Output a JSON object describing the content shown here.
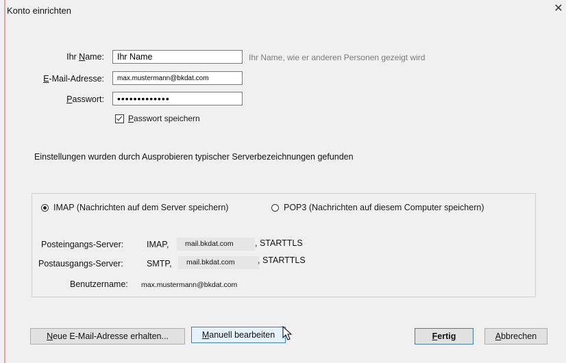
{
  "window": {
    "title": "Konto einrichten",
    "close_symbol": "✕"
  },
  "form": {
    "name": {
      "label_pre": "Ihr ",
      "label_u": "N",
      "label_post": "ame:",
      "value": "Ihr Name",
      "hint": "Ihr Name, wie er anderen Personen gezeigt wird"
    },
    "email": {
      "label_u": "E",
      "label_post": "-Mail-Adresse:",
      "value": "max.mustermann@bkdat.com"
    },
    "password": {
      "label_u": "P",
      "label_post": "asswort:",
      "value": "•••••••••••••"
    },
    "remember": {
      "label_u": "P",
      "label_post": "asswort speichern",
      "checked": true
    }
  },
  "info": "Einstellungen wurden durch Ausprobieren typischer Serverbezeichnungen gefunden",
  "protocols": {
    "imap_label": "IMAP (Nachrichten auf dem Server speichern)",
    "pop3_label": "POP3 (Nachrichten auf diesem Computer speichern)",
    "selected": "IMAP"
  },
  "servers": {
    "incoming": {
      "label": "Posteingangs-Server:",
      "protocol": "IMAP,",
      "host": "mail.bkdat.com",
      "security": ", STARTTLS"
    },
    "outgoing": {
      "label": "Postausgangs-Server:",
      "protocol": "SMTP,",
      "host": "mail.bkdat.com",
      "security": ", STARTTLS"
    },
    "username": {
      "label": "Benutzername:",
      "value": "max.mustermann@bkdat.com"
    }
  },
  "buttons": {
    "new_address": {
      "u": "N",
      "rest": "eue E-Mail-Adresse erhalten..."
    },
    "manual": {
      "u": "M",
      "rest": "anuell bearbeiten"
    },
    "done": {
      "u": "F",
      "rest": "ertig"
    },
    "cancel": {
      "u": "A",
      "rest": "bbrechen"
    }
  },
  "colors": {
    "window_bg": "#f0f0f0",
    "button_bg": "#e1e1e1",
    "focus_border": "#3c7fb1",
    "hint_text": "#7a7a7a"
  }
}
